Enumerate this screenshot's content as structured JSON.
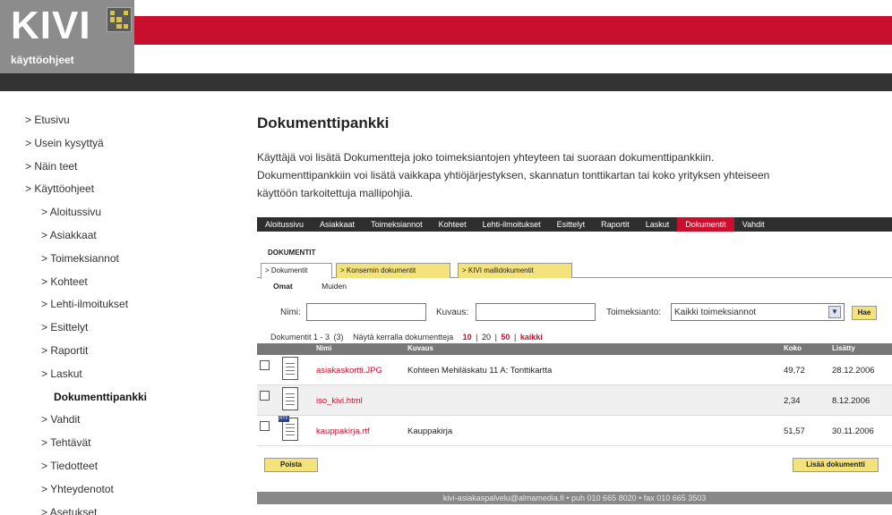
{
  "header": {
    "logo_title": "KIVI",
    "logo_subtitle": "käyttöohjeet",
    "brand_red": "#c8102e"
  },
  "left_nav": {
    "items": [
      {
        "label": "> Etusivu"
      },
      {
        "label": "> Usein kysyttyä"
      },
      {
        "label": "> Näin teet"
      },
      {
        "label": "> Käyttöohjeet"
      },
      {
        "label": "> Aloitussivu"
      },
      {
        "label": "> Asiakkaat"
      },
      {
        "label": "> Toimeksiannot"
      },
      {
        "label": "> Kohteet"
      },
      {
        "label": "> Lehti-ilmoitukset"
      },
      {
        "label": "> Esittelyt"
      },
      {
        "label": "> Raportit"
      },
      {
        "label": "> Laskut"
      },
      {
        "label": "Dokumenttipankki"
      },
      {
        "label": "> Vahdit"
      },
      {
        "label": "> Tehtävät"
      },
      {
        "label": "> Tiedotteet"
      },
      {
        "label": "> Yhteydenotot"
      },
      {
        "label": "> Asetukset"
      }
    ]
  },
  "main": {
    "title": "Dokumenttipankki",
    "intro_line1": "Käyttäjä voi lisätä Dokumentteja joko toimeksiantojen yhteyteen tai suoraan dokumenttipankkiin.",
    "intro_line2": "Dokumenttipankkiin voi lisätä vaikkapa yhtiöjärjestyksen, skannatun tonttikartan tai koko yrityksen yhteiseen",
    "intro_line3": "käyttöön tarkoitettuja mallipohjia."
  },
  "menubar": {
    "items": [
      {
        "label": "Aloitussivu"
      },
      {
        "label": "Asiakkaat"
      },
      {
        "label": "Toimeksiannot"
      },
      {
        "label": "Kohteet"
      },
      {
        "label": "Lehti-ilmoitukset"
      },
      {
        "label": "Esittelyt"
      },
      {
        "label": "Raportit"
      },
      {
        "label": "Laskut"
      },
      {
        "label": "Dokumentit"
      },
      {
        "label": "Vahdit"
      }
    ]
  },
  "documents": {
    "section_title": "DOKUMENTIT",
    "tabs": [
      {
        "label": "> Dokumentit"
      },
      {
        "label": "> Konsernin dokumentit"
      },
      {
        "label": "> KIVI mallidokumentit"
      }
    ],
    "subtabs": [
      {
        "label": "Omat"
      },
      {
        "label": "Muiden"
      }
    ],
    "search": {
      "name_label": "Nimi:",
      "name_value": "",
      "desc_label": "Kuvaus:",
      "desc_value": "",
      "assignment_label": "Toimeksianto:",
      "assignment_value": "Kaikki toimeksiannot",
      "search_button": "Hae"
    },
    "paging": {
      "range": "Dokumentit 1 - 3",
      "count": "(3)",
      "per_page_label": "Näytä kerralla dokumentteja",
      "opt10": "10",
      "sep1": "|",
      "opt20": "20",
      "sep2": "|",
      "opt50": "50",
      "sep3": "|",
      "opt_all": "kaikki"
    },
    "columns": {
      "name": "Nimi",
      "desc": "Kuvaus",
      "size": "Koko",
      "added": "Lisätty"
    },
    "rows": [
      {
        "name": "asiakaskortti.JPG",
        "desc": "Kohteen Mehiläskatu 11 A: Tonttikartta",
        "size": "49,72",
        "date": "28.12.2006",
        "icon_badge": ""
      },
      {
        "name": "iso_kivi.html",
        "desc": "",
        "size": "2,34",
        "date": "8.12.2006",
        "icon_badge": ""
      },
      {
        "name": "kauppakirja.rtf",
        "desc": "Kauppakirja",
        "size": "51,57",
        "date": "30.11.2006",
        "icon_badge": "RTF"
      }
    ],
    "delete_button": "Poista",
    "add_button": "Lisää dokumentti"
  },
  "footer": {
    "text": "kivi-asiakaspalvelu@almamedia.fi   •   puh 010 665 8020   •   fax 010 665 3503"
  }
}
